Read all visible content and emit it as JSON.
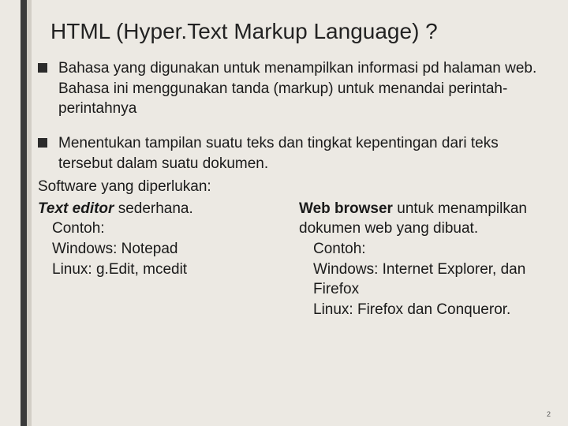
{
  "title": "HTML (Hyper.Text Markup Language) ?",
  "bullets": [
    "Bahasa yang digunakan untuk menampilkan informasi pd halaman web. Bahasa ini menggunakan tanda (markup) untuk menandai perintah-perintahnya",
    "Menentukan tampilan suatu teks dan tingkat kepentingan dari teks tersebut dalam suatu dokumen."
  ],
  "software_heading": "Software yang diperlukan:",
  "left": {
    "lead_bold": "Text editor",
    "lead_rest": " sederhana.",
    "contoh": "Contoh:",
    "win": "Windows: Notepad",
    "linux": "Linux: g.Edit, mcedit"
  },
  "right": {
    "lead_bold": "Web browser",
    "lead_rest": " untuk menampilkan dokumen web yang dibuat.",
    "contoh": "Contoh:",
    "win": "Windows: Internet Explorer, dan Firefox",
    "linux": "Linux: Firefox dan Conqueror."
  },
  "page_number": "2"
}
